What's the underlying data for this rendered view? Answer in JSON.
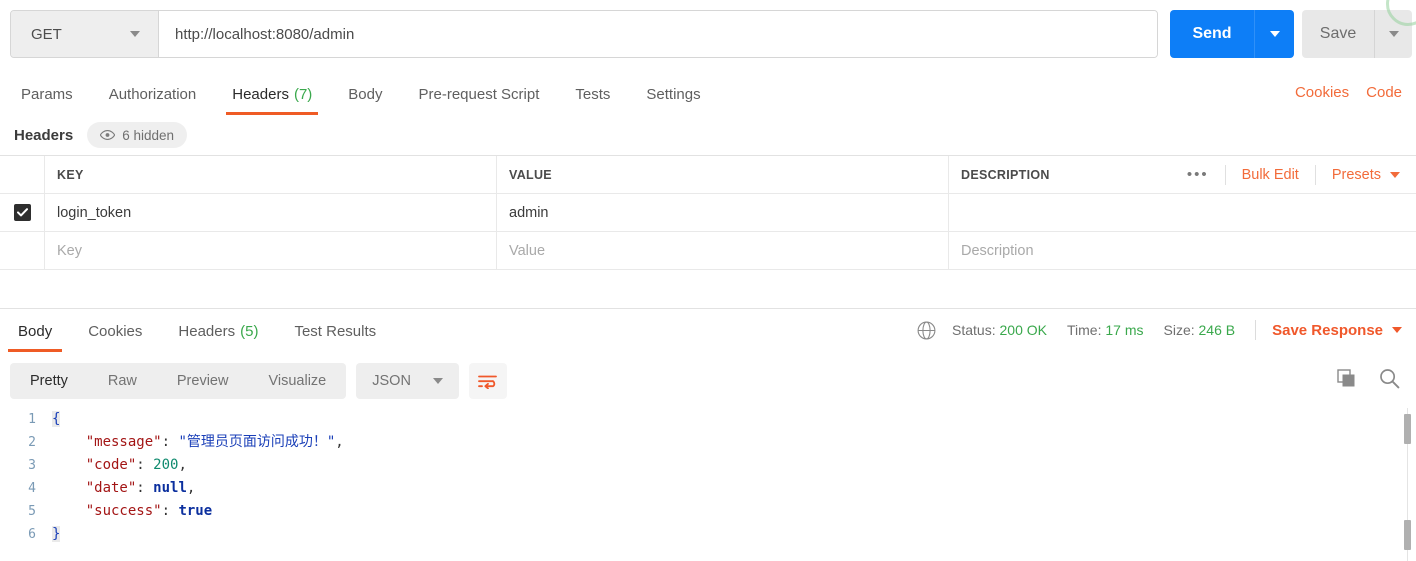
{
  "request": {
    "method": "GET",
    "url": "http://localhost:8080/admin",
    "send_label": "Send",
    "save_label": "Save",
    "tabs": [
      {
        "label": "Params",
        "count": "",
        "active": false
      },
      {
        "label": "Authorization",
        "count": "",
        "active": false
      },
      {
        "label": "Headers",
        "count": "(7)",
        "active": true
      },
      {
        "label": "Body",
        "count": "",
        "active": false
      },
      {
        "label": "Pre-request Script",
        "count": "",
        "active": false
      },
      {
        "label": "Tests",
        "count": "",
        "active": false
      },
      {
        "label": "Settings",
        "count": "",
        "active": false
      }
    ],
    "links": [
      "Cookies",
      "Code"
    ]
  },
  "headers_panel": {
    "title": "Headers",
    "hidden_pill": "6 hidden",
    "eye_icon": "eye-icon",
    "columns": [
      "KEY",
      "VALUE",
      "DESCRIPTION"
    ],
    "actions": {
      "menu": "•••",
      "bulk_edit": "Bulk Edit",
      "presets": "Presets"
    },
    "rows": [
      {
        "checked": true,
        "key": "login_token",
        "value": "admin",
        "description": ""
      }
    ],
    "placeholder_row": {
      "key": "Key",
      "value": "Value",
      "description": "Description"
    }
  },
  "response": {
    "tabs": [
      {
        "label": "Body",
        "count": "",
        "active": true
      },
      {
        "label": "Cookies",
        "count": "",
        "active": false
      },
      {
        "label": "Headers",
        "count": "(5)",
        "active": false
      },
      {
        "label": "Test Results",
        "count": "",
        "active": false
      }
    ],
    "globe_icon": "globe-icon",
    "status_label": "Status:",
    "status_value": "200 OK",
    "time_label": "Time:",
    "time_value": "17 ms",
    "size_label": "Size:",
    "size_value": "246 B",
    "save_response": "Save Response",
    "view_modes": [
      {
        "label": "Pretty",
        "active": true
      },
      {
        "label": "Raw",
        "active": false
      },
      {
        "label": "Preview",
        "active": false
      },
      {
        "label": "Visualize",
        "active": false
      }
    ],
    "format": "JSON",
    "wrap_icon": "word-wrap-icon",
    "copy_icon": "copy-icon",
    "search_icon": "search-icon",
    "body_lines": [
      {
        "n": "1",
        "tokens": [
          {
            "t": "{",
            "c": "brace"
          }
        ]
      },
      {
        "n": "2",
        "tokens": [
          {
            "t": "    ",
            "c": "k-pun"
          },
          {
            "t": "\"message\"",
            "c": "k-key"
          },
          {
            "t": ": ",
            "c": "k-pun"
          },
          {
            "t": "\"管理员页面访问成功！\"",
            "c": "k-str"
          },
          {
            "t": ",",
            "c": "k-pun"
          }
        ]
      },
      {
        "n": "3",
        "tokens": [
          {
            "t": "    ",
            "c": "k-pun"
          },
          {
            "t": "\"code\"",
            "c": "k-key"
          },
          {
            "t": ": ",
            "c": "k-pun"
          },
          {
            "t": "200",
            "c": "k-num"
          },
          {
            "t": ",",
            "c": "k-pun"
          }
        ]
      },
      {
        "n": "4",
        "tokens": [
          {
            "t": "    ",
            "c": "k-pun"
          },
          {
            "t": "\"date\"",
            "c": "k-key"
          },
          {
            "t": ": ",
            "c": "k-pun"
          },
          {
            "t": "null",
            "c": "k-lit"
          },
          {
            "t": ",",
            "c": "k-pun"
          }
        ]
      },
      {
        "n": "5",
        "tokens": [
          {
            "t": "    ",
            "c": "k-pun"
          },
          {
            "t": "\"success\"",
            "c": "k-key"
          },
          {
            "t": ": ",
            "c": "k-pun"
          },
          {
            "t": "true",
            "c": "k-lit"
          }
        ]
      },
      {
        "n": "6",
        "tokens": [
          {
            "t": "}",
            "c": "brace"
          }
        ]
      }
    ]
  },
  "colors": {
    "accent_orange": "#ef5b25",
    "link_orange": "#f26b3a",
    "send_blue": "#0d7ef7",
    "success_green": "#3aa84c"
  }
}
